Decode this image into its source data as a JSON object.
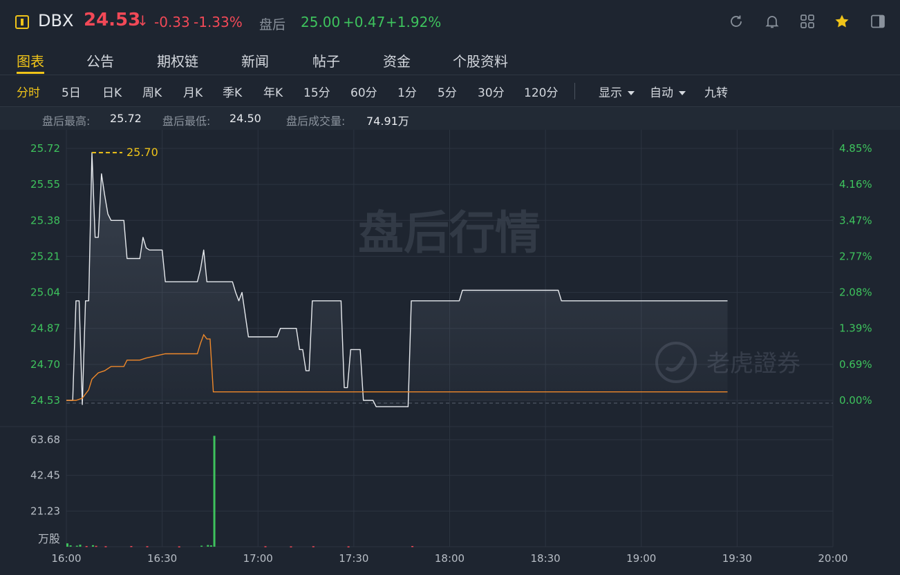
{
  "header": {
    "symbol": "DBX",
    "price": "24.53",
    "change": "-0.33",
    "change_pct": "-1.33%",
    "after_hours_label": "盘后",
    "after_hours_price": "25.00",
    "after_hours_change": "+0.47",
    "after_hours_change_pct": "+1.92%",
    "icons": [
      "refresh-icon",
      "bell-icon",
      "grid-icon",
      "star-icon",
      "panel-toggle-icon"
    ],
    "colors": {
      "down": "#f24957",
      "up": "#3ec35d",
      "accent": "#f0c419"
    }
  },
  "tabs": [
    "图表",
    "公告",
    "期权链",
    "新闻",
    "帖子",
    "资金",
    "个股资料"
  ],
  "active_tab": "图表",
  "periods": [
    "分时",
    "5日",
    "日K",
    "周K",
    "月K",
    "季K",
    "年K",
    "15分",
    "60分",
    "1分",
    "5分",
    "30分",
    "120分"
  ],
  "active_period": "分时",
  "dropdowns": {
    "display": "显示",
    "auto": "自动"
  },
  "nine_turn": "九转",
  "stats": {
    "high_label": "盘后最高:",
    "high": "25.72",
    "low_label": "盘后最低:",
    "low": "24.50",
    "volume_label": "盘后成交量:",
    "volume": "74.91万"
  },
  "watermark": "盘后行情",
  "brand_watermark": "老虎證券",
  "chart_data": [
    {
      "type": "line",
      "series": [],
      "x_ticks": [
        "16:00",
        "16:30",
        "17:00",
        "17:30",
        "18:00",
        "18:30",
        "19:00",
        "19:30",
        "20:00"
      ],
      "y_ticks_left": [
        "25.72",
        "25.55",
        "25.38",
        "25.21",
        "25.04",
        "24.87",
        "24.70",
        "24.53"
      ],
      "y_ticks_right": [
        "4.85%",
        "4.16%",
        "3.47%",
        "2.77%",
        "2.08%",
        "1.39%",
        "0.69%",
        "0.00%"
      ],
      "ylim": [
        24.53,
        25.72
      ],
      "prev_close": 24.53,
      "max_marker": "25.70",
      "min_marker": "24.50",
      "price_points": [
        [
          "16:00",
          24.53
        ],
        [
          "16:02",
          24.53
        ],
        [
          "16:03",
          25.0
        ],
        [
          "16:04",
          25.0
        ],
        [
          "16:05",
          24.51
        ],
        [
          "16:06",
          25.0
        ],
        [
          "16:07",
          25.0
        ],
        [
          "16:08",
          25.7
        ],
        [
          "16:09",
          25.3
        ],
        [
          "16:10",
          25.3
        ],
        [
          "16:11",
          25.6
        ],
        [
          "16:12",
          25.5
        ],
        [
          "16:13",
          25.41
        ],
        [
          "16:14",
          25.38
        ],
        [
          "16:18",
          25.38
        ],
        [
          "16:19",
          25.2
        ],
        [
          "16:23",
          25.2
        ],
        [
          "16:24",
          25.3
        ],
        [
          "16:25",
          25.25
        ],
        [
          "16:26",
          25.24
        ],
        [
          "16:30",
          25.24
        ],
        [
          "16:31",
          25.09
        ],
        [
          "16:41",
          25.09
        ],
        [
          "16:42",
          25.15
        ],
        [
          "16:43",
          25.24
        ],
        [
          "16:44",
          25.09
        ],
        [
          "16:52",
          25.09
        ],
        [
          "16:53",
          25.04
        ],
        [
          "16:54",
          25.0
        ],
        [
          "16:55",
          25.04
        ],
        [
          "16:57",
          24.83
        ],
        [
          "17:06",
          24.83
        ],
        [
          "17:07",
          24.87
        ],
        [
          "17:12",
          24.87
        ],
        [
          "17:13",
          24.77
        ],
        [
          "17:14",
          24.77
        ],
        [
          "17:15",
          24.67
        ],
        [
          "17:16",
          24.67
        ],
        [
          "17:17",
          25.0
        ],
        [
          "17:26",
          25.0
        ],
        [
          "17:27",
          24.59
        ],
        [
          "17:28",
          24.59
        ],
        [
          "17:29",
          24.77
        ],
        [
          "17:32",
          24.77
        ],
        [
          "17:33",
          24.53
        ],
        [
          "17:36",
          24.53
        ],
        [
          "17:37",
          24.5
        ],
        [
          "17:47",
          24.5
        ],
        [
          "17:48",
          25.0
        ],
        [
          "18:03",
          25.0
        ],
        [
          "18:04",
          25.05
        ],
        [
          "18:34",
          25.05
        ],
        [
          "18:35",
          25.0
        ],
        [
          "19:27",
          25.0
        ]
      ],
      "avg_points": [
        [
          "16:00",
          24.53
        ],
        [
          "16:03",
          24.53
        ],
        [
          "16:05",
          24.54
        ],
        [
          "16:07",
          24.58
        ],
        [
          "16:08",
          24.63
        ],
        [
          "16:10",
          24.66
        ],
        [
          "16:12",
          24.67
        ],
        [
          "16:14",
          24.69
        ],
        [
          "16:18",
          24.69
        ],
        [
          "16:19",
          24.72
        ],
        [
          "16:23",
          24.72
        ],
        [
          "16:25",
          24.73
        ],
        [
          "16:28",
          24.74
        ],
        [
          "16:31",
          24.75
        ],
        [
          "16:41",
          24.75
        ],
        [
          "16:42",
          24.8
        ],
        [
          "16:43",
          24.84
        ],
        [
          "16:44",
          24.82
        ],
        [
          "16:45",
          24.82
        ],
        [
          "16:46",
          24.57
        ],
        [
          "17:00",
          24.57
        ],
        [
          "17:30",
          24.57
        ],
        [
          "18:30",
          24.57
        ],
        [
          "19:27",
          24.57
        ]
      ]
    },
    {
      "type": "bar",
      "ylabel": "万股",
      "y_ticks": [
        "63.68",
        "42.45",
        "21.23"
      ],
      "ylim": [
        0,
        63.68
      ],
      "bars": [
        [
          "16:00",
          2.0
        ],
        [
          "16:01",
          0.8
        ],
        [
          "16:03",
          0.6
        ],
        [
          "16:04",
          1.2
        ],
        [
          "16:06",
          0.4
        ],
        [
          "16:08",
          0.9
        ],
        [
          "16:09",
          0.5
        ],
        [
          "16:12",
          0.3
        ],
        [
          "16:20",
          0.4
        ],
        [
          "16:25",
          0.3
        ],
        [
          "16:35",
          0.2
        ],
        [
          "16:42",
          0.6
        ],
        [
          "16:44",
          1.0
        ],
        [
          "16:45",
          0.8
        ],
        [
          "16:46",
          66.0
        ],
        [
          "17:02",
          0.3
        ],
        [
          "17:10",
          0.2
        ],
        [
          "17:17",
          0.3
        ],
        [
          "17:28",
          0.2
        ],
        [
          "17:48",
          0.4
        ]
      ]
    }
  ]
}
